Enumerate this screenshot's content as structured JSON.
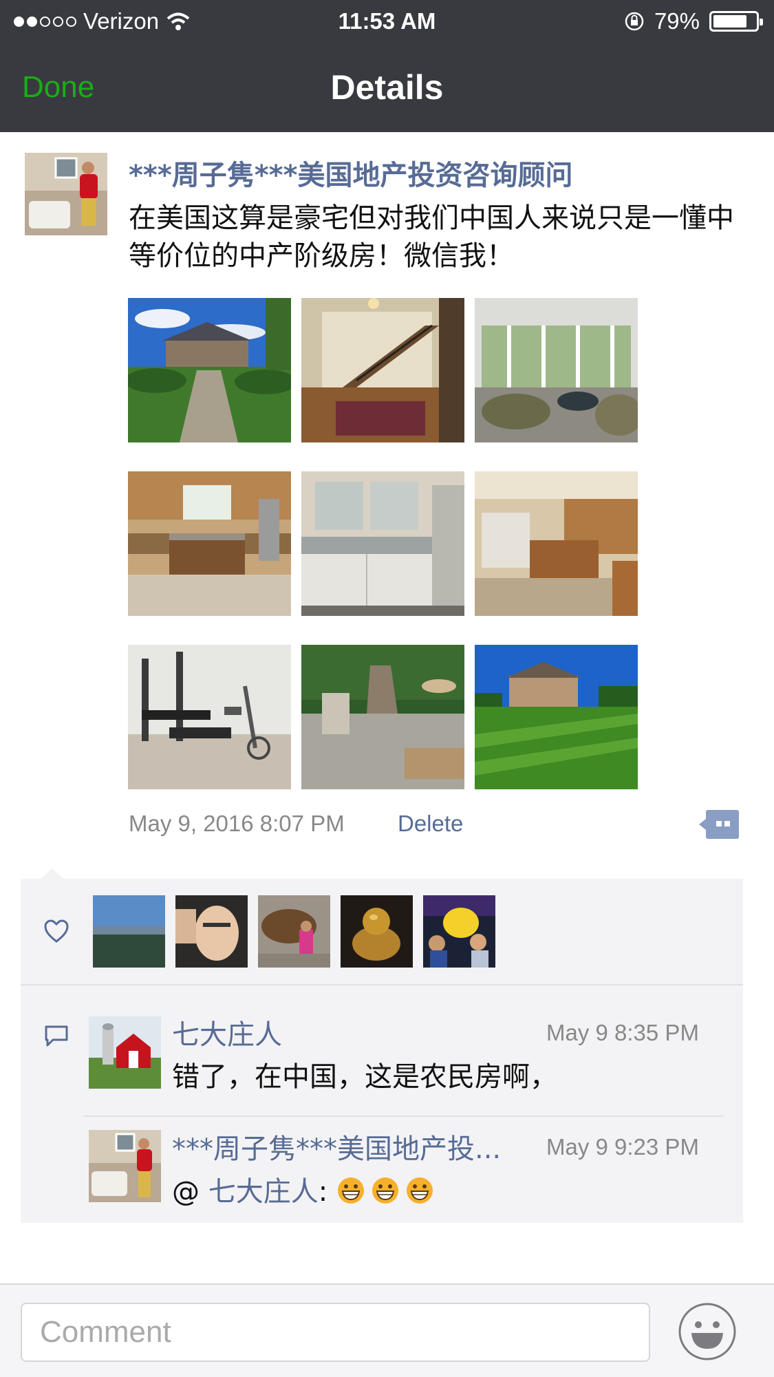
{
  "status_bar": {
    "carrier": "Verizon",
    "time": "11:53 AM",
    "battery": "79%",
    "battery_level": 0.79
  },
  "nav": {
    "done_label": "Done",
    "title": "Details"
  },
  "post": {
    "author": "***周子隽***美国地产投资咨询顾问",
    "text": "在美国这算是豪宅但对我们中国人来说只是一懂中等价位的中产阶级房！微信我！",
    "timestamp": "May 9, 2016 8:07 PM",
    "delete_label": "Delete",
    "photos": [
      {
        "icon": "house-front-photo"
      },
      {
        "icon": "staircase-photo"
      },
      {
        "icon": "sunroom-photo"
      },
      {
        "icon": "kitchen-photo"
      },
      {
        "icon": "bathroom-photo"
      },
      {
        "icon": "kitchen-island-photo"
      },
      {
        "icon": "home-gym-photo"
      },
      {
        "icon": "patio-photo"
      },
      {
        "icon": "backyard-lawn-photo"
      }
    ]
  },
  "likes": {
    "icon": "heart-icon",
    "avatars": [
      "landscape-avatar",
      "man-avatar",
      "bull-statue-avatar",
      "golden-buddha-avatar",
      "pikachu-avatar"
    ]
  },
  "comments": [
    {
      "author": "七大庄人",
      "time": "May 9 8:35 PM",
      "text": "错了，在中国，这是农民房啊，"
    },
    {
      "author": "***周子隽***美国地产投...",
      "time": "May 9 9:23 PM",
      "mention_prefix": "@ ",
      "mention": "七大庄人",
      "text_suffix": ": ",
      "emoji": [
        "grinning-emoji",
        "grinning-emoji",
        "grinning-emoji"
      ]
    }
  ],
  "composer": {
    "placeholder": "Comment",
    "emoji_button": "smiley-icon"
  },
  "colors": {
    "bar_bg": "#393a3f",
    "done_green": "#1aad19",
    "link_blue": "#576b95",
    "panel_bg": "#f3f3f5"
  }
}
